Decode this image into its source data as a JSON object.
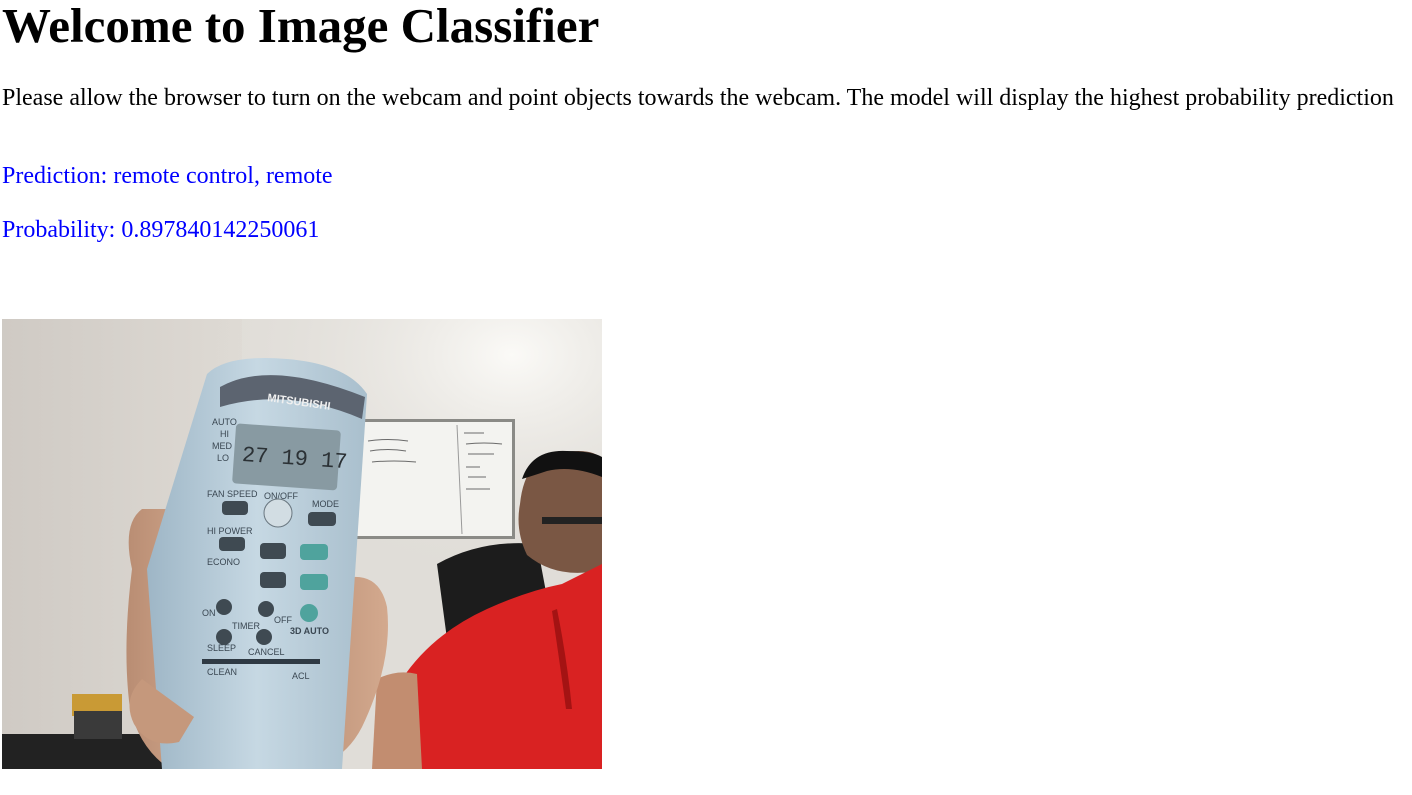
{
  "page": {
    "title": "Welcome to Image Classifier",
    "instructions": "Please allow the browser to turn on the webcam and point objects towards the webcam. The model will display the highest probability prediction"
  },
  "result": {
    "prediction_label": "Prediction:",
    "prediction_value": "remote control, remote",
    "probability_label": "Probability:",
    "probability_value": "0.897840142250061",
    "text_color": "#0000ff"
  },
  "webcam": {
    "remote_brand": "MITSUBISHI",
    "remote_display": "27 19 17",
    "remote_labels": {
      "auto": "AUTO",
      "hi": "HI",
      "med": "MED",
      "lo": "LO",
      "fan_speed": "FAN SPEED",
      "on_off": "ON/OFF",
      "mode": "MODE",
      "hi_power": "HI POWER",
      "econo": "ECONO",
      "on": "ON",
      "off": "OFF",
      "timer": "TIMER",
      "auto_3d": "3D AUTO",
      "sleep": "SLEEP",
      "cancel": "CANCEL",
      "clean": "CLEAN",
      "acl": "ACL"
    }
  }
}
